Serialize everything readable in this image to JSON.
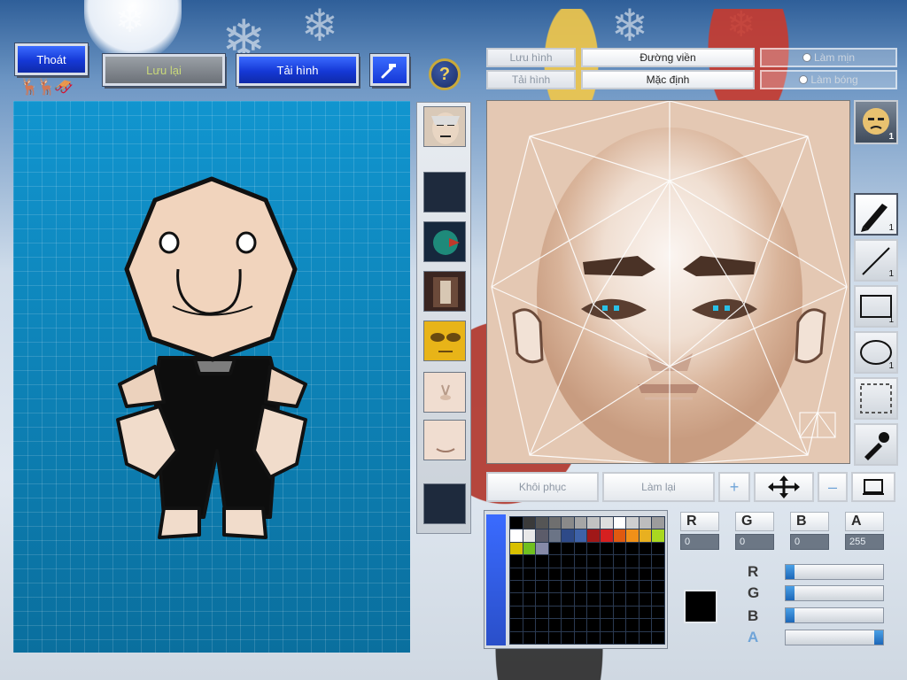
{
  "top_left": {
    "exit_label": "Thoát",
    "save_label": "Lưu lại",
    "reload_label": "Tải hình",
    "tool_icon": "hammer-icon"
  },
  "help": {
    "label": "?"
  },
  "top_right": {
    "save_image_label": "Lưu hình",
    "load_image_label": "Tải hình",
    "outline_label": "Đường viền",
    "default_label": "Mặc định",
    "smooth_label": "Làm mịn",
    "shine_label": "Làm bóng"
  },
  "head_badge": {
    "count": "1"
  },
  "right_tools": [
    {
      "name": "brush-tool",
      "icon": "brush-icon",
      "count": "1"
    },
    {
      "name": "line-tool",
      "icon": "line-icon",
      "count": "1"
    },
    {
      "name": "rectangle-tool",
      "icon": "rectangle-icon",
      "count": "1"
    },
    {
      "name": "ellipse-tool",
      "icon": "ellipse-icon",
      "count": "1"
    },
    {
      "name": "select-tool",
      "icon": "dashed-rect-icon",
      "count": ""
    },
    {
      "name": "eyedropper-tool",
      "icon": "eyedropper-icon",
      "count": ""
    }
  ],
  "bottom": {
    "restore_label": "Khôi phục",
    "redo_label": "Làm lại",
    "zoom_in_icon": "plus-icon",
    "move_icon": "move-arrows-icon",
    "zoom_out_icon": "minus-icon",
    "frame_icon": "frame-icon"
  },
  "palette": {
    "row1": [
      "#000000",
      "#3a3a3a",
      "#555555",
      "#6f6f6f",
      "#8a8a8a",
      "#a6a6a6",
      "#c2c2c2",
      "#dedede",
      "#ffffff",
      "#cfcfcf",
      "#bdbdbd",
      "#9c9c9c"
    ],
    "row2": [
      "#ffffff",
      "#e8e8e8",
      "#5c5c6a",
      "#6b7486",
      "#2e4a88",
      "#3e62a8",
      "#a01818",
      "#d62020",
      "#e05a10",
      "#f09018",
      "#e8b020",
      "#a9d820"
    ],
    "row3": [
      "#d8c000",
      "#70c020",
      "#868aa8"
    ]
  },
  "color": {
    "r_label": "R",
    "g_label": "G",
    "b_label": "B",
    "a_label": "A",
    "r": "0",
    "g": "0",
    "b": "0",
    "a": "255",
    "current": "#000000",
    "r_level": 0,
    "g_level": 0,
    "b_level": 0,
    "a_level": 1
  }
}
